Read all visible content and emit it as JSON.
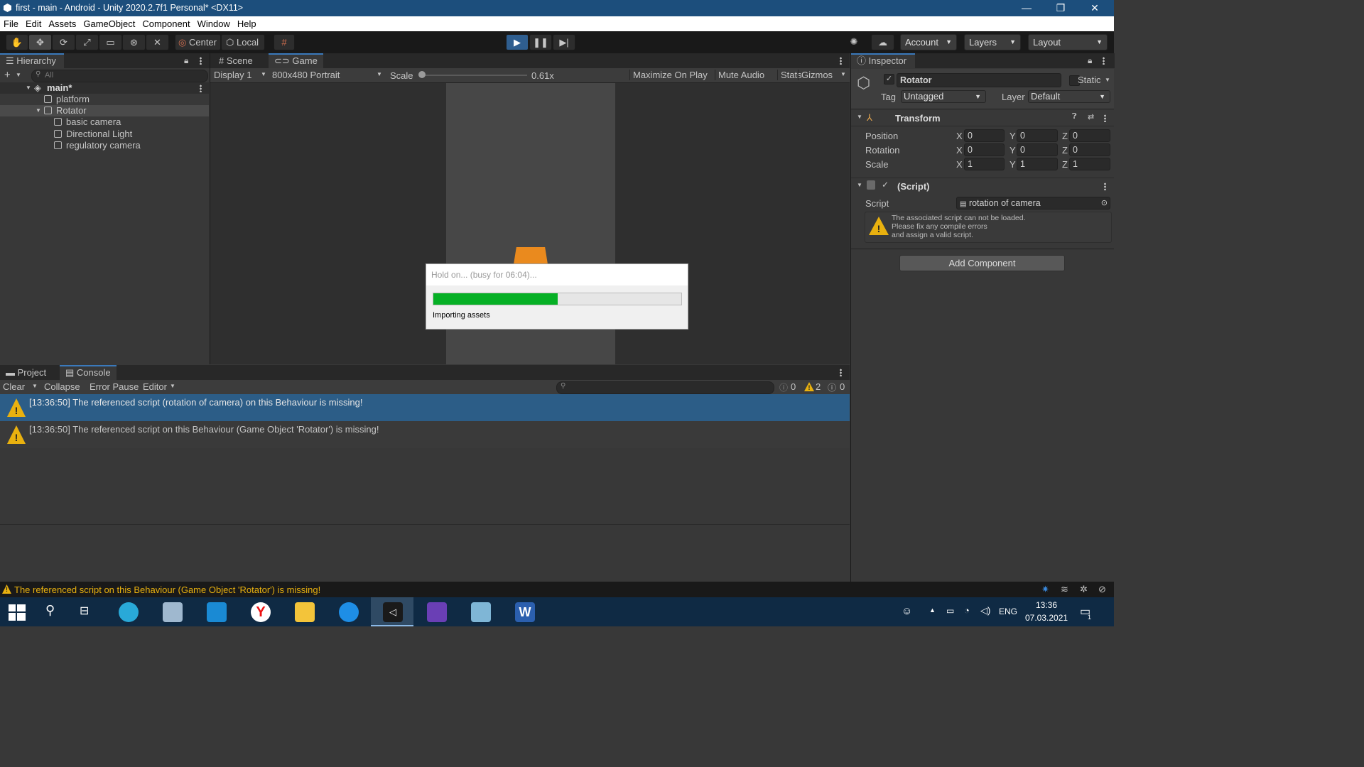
{
  "window": {
    "title": "first - main - Android - Unity 2020.2.7f1 Personal* <DX11>",
    "minimize": "—",
    "maximize": "❐",
    "close": "✕"
  },
  "menu": [
    "File",
    "Edit",
    "Assets",
    "GameObject",
    "Component",
    "Window",
    "Help"
  ],
  "toolbar": {
    "pivot": "Center",
    "space": "Local",
    "account": "Account",
    "layers": "Layers",
    "layout": "Layout"
  },
  "hierarchy": {
    "tab": "Hierarchy",
    "search_placeholder": "All",
    "scene": "main*",
    "items": [
      "platform",
      "Rotator",
      "basic camera",
      "Directional Light",
      "regulatory camera"
    ]
  },
  "game_view": {
    "tabs": [
      "Scene",
      "Game"
    ],
    "display": "Display 1",
    "resolution": "800x480 Portrait",
    "scale_label": "Scale",
    "scale_value": "0.61x",
    "scale_fraction": 0.0,
    "buttons": [
      "Maximize On Play",
      "Mute Audio",
      "Stats",
      "Gizmos"
    ]
  },
  "progress_dialog": {
    "title": "Hold on... (busy for 06:04)...",
    "progress": 0.5,
    "status": "Importing assets",
    "bar_color": "#06b025"
  },
  "inspector": {
    "tab": "Inspector",
    "object_name": "Rotator",
    "static_label": "Static",
    "tag_label": "Tag",
    "tag_value": "Untagged",
    "layer_label": "Layer",
    "layer_value": "Default",
    "transform": {
      "title": "Transform",
      "rows": [
        {
          "label": "Position",
          "x": "0",
          "y": "0",
          "z": "0"
        },
        {
          "label": "Rotation",
          "x": "0",
          "y": "0",
          "z": "0"
        },
        {
          "label": "Scale",
          "x": "1",
          "y": "1",
          "z": "1"
        }
      ],
      "axis_x": "X",
      "axis_y": "Y",
      "axis_z": "Z"
    },
    "script": {
      "title": "(Script)",
      "label": "Script",
      "value": "rotation of camera",
      "warning_line1": "The associated script can not be loaded.",
      "warning_line2": "Please fix any compile errors",
      "warning_line3": "and assign a valid script."
    },
    "add_component": "Add Component"
  },
  "console": {
    "tabs": [
      "Project",
      "Console"
    ],
    "clear": "Clear",
    "collapse": "Collapse",
    "error_pause": "Error Pause",
    "editor": "Editor",
    "counts": {
      "info": "0",
      "warn": "2",
      "error": "0"
    },
    "messages": [
      "[13:36:50] The referenced script (rotation of camera) on this Behaviour is missing!",
      "[13:36:50] The referenced script on this Behaviour (Game Object 'Rotator') is missing!"
    ]
  },
  "status_bar": {
    "message": "The referenced script on this Behaviour (Game Object 'Rotator') is missing!"
  },
  "taskbar": {
    "language": "ENG",
    "time": "13:36",
    "date": "07.03.2021",
    "notifications": "1"
  },
  "colors": {
    "accent": "#3a79bb",
    "selection": "#2c5d87",
    "warning": "#e9b10f",
    "title_bar": "#1c4e7c"
  }
}
